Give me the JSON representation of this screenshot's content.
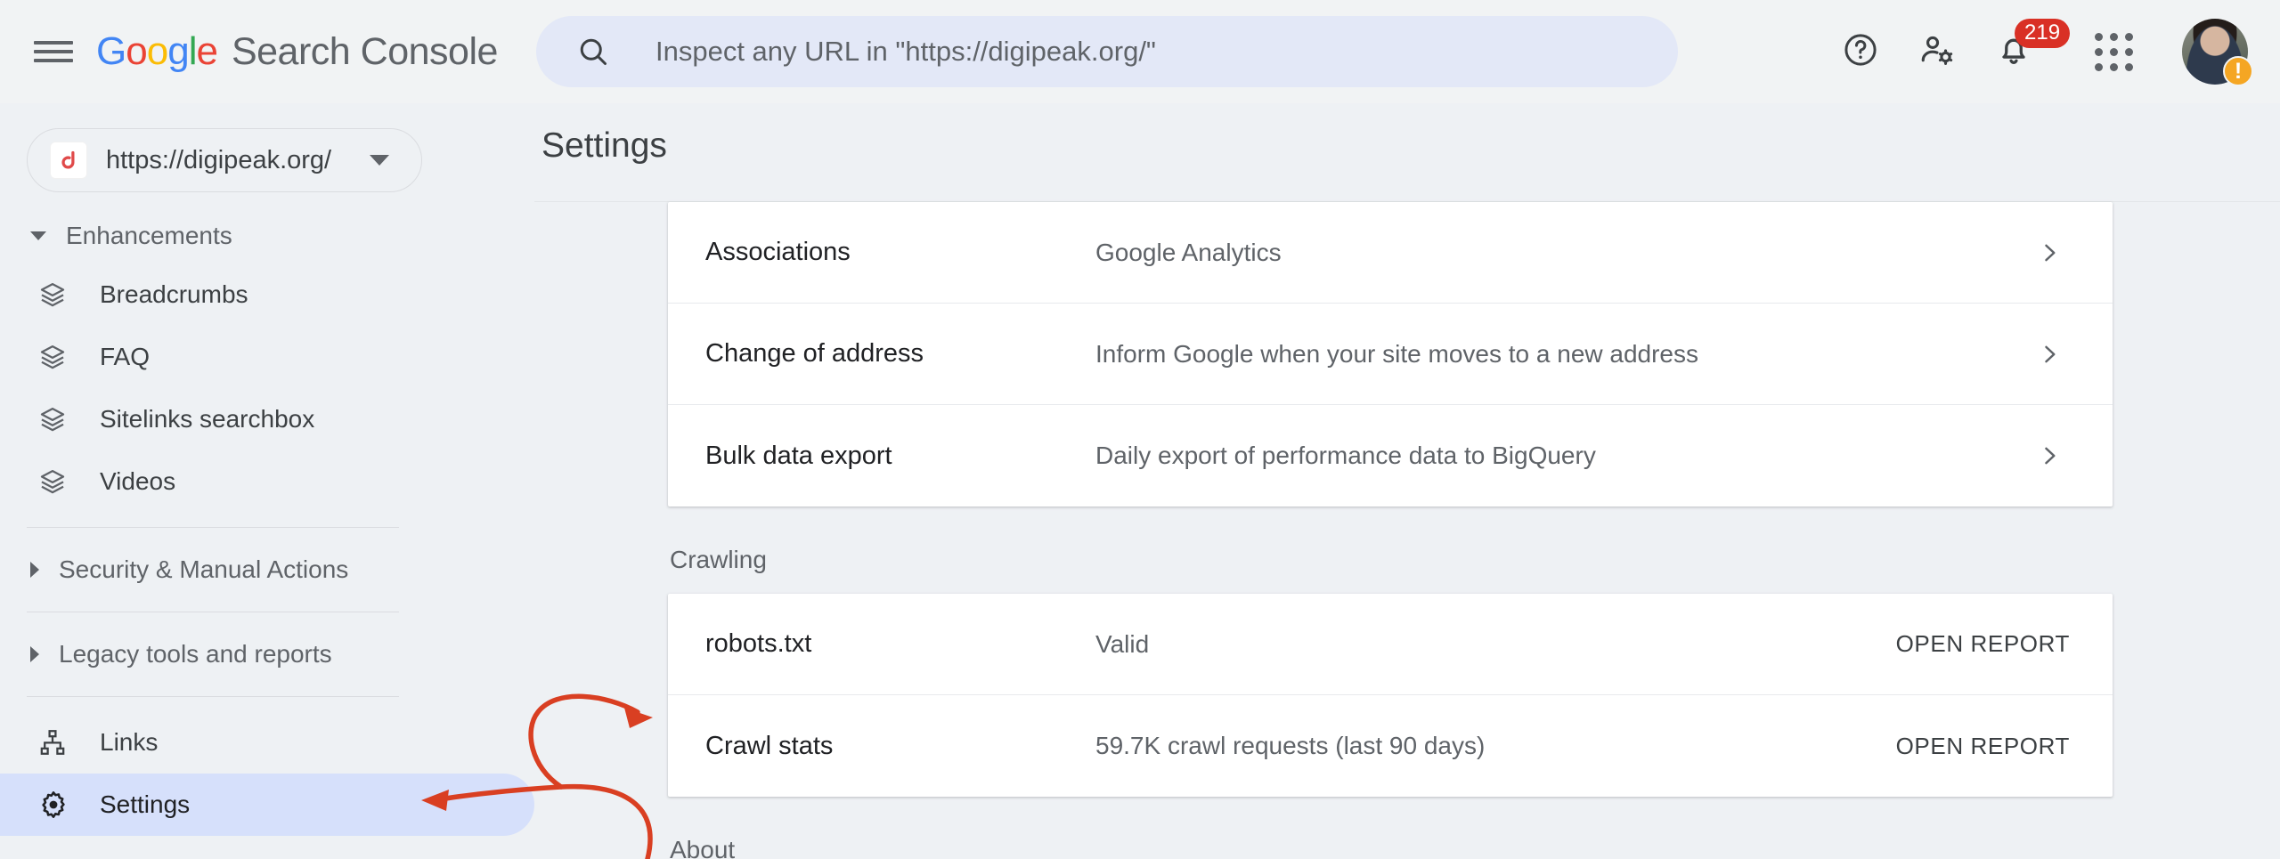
{
  "topbar": {
    "menu_icon": "hamburger-menu-icon",
    "logo_google": "Google",
    "logo_product": "Search Console",
    "search": {
      "icon": "search-icon",
      "placeholder": "Inspect any URL in \"https://digipeak.org/\""
    },
    "help_icon": "help-circle-icon",
    "user_settings_icon": "user-settings-icon",
    "notifications_icon": "notifications-bell-icon",
    "notifications_count": "219",
    "apps_icon": "apps-grid-icon",
    "avatar": "user-avatar",
    "avatar_badge": "!"
  },
  "sidebar": {
    "property": {
      "favicon_letter": "d",
      "url": "https://digipeak.org/",
      "caret": "chevron-down-icon"
    },
    "groups": [
      {
        "label": "Enhancements",
        "expanded": true,
        "items": [
          {
            "label": "Breadcrumbs",
            "icon": "layers-icon"
          },
          {
            "label": "FAQ",
            "icon": "layers-icon"
          },
          {
            "label": "Sitelinks searchbox",
            "icon": "layers-icon"
          },
          {
            "label": "Videos",
            "icon": "layers-icon"
          }
        ]
      },
      {
        "label": "Security & Manual Actions",
        "expanded": false,
        "items": []
      },
      {
        "label": "Legacy tools and reports",
        "expanded": false,
        "items": []
      }
    ],
    "links_item": {
      "label": "Links",
      "icon": "sitemap-icon",
      "active": false
    },
    "settings_item": {
      "label": "Settings",
      "icon": "gear-icon",
      "active": true
    }
  },
  "main": {
    "title": "Settings",
    "top_rows": [
      {
        "title": "Associations",
        "desc": "Google Analytics",
        "action": "chevron-right-icon"
      },
      {
        "title": "Change of address",
        "desc": "Inform Google when your site moves to a new address",
        "action": "chevron-right-icon"
      },
      {
        "title": "Bulk data export",
        "desc": "Daily export of performance data to BigQuery",
        "action": "chevron-right-icon"
      }
    ],
    "crawling_label": "Crawling",
    "crawling_rows": [
      {
        "title": "robots.txt",
        "desc": "Valid",
        "action_label": "Open report"
      },
      {
        "title": "Crawl stats",
        "desc": "59.7K crawl requests (last 90 days)",
        "action_label": "Open report"
      }
    ],
    "about_label": "About"
  },
  "annotation": {
    "color": "#d93f22",
    "shape": "double-headed-curved-arrow"
  },
  "colors": {
    "page_bg": "#eef1f4",
    "topbar_bg": "#f1f3f4",
    "card_bg": "#ffffff",
    "active_nav": "#d6e0fb",
    "search_bg": "#e3e8f7",
    "badge_red": "#d93025",
    "avatar_badge": "#f5a623",
    "annotation_red": "#d93f22",
    "google_blue": "#4285f4",
    "google_red": "#ea4335",
    "google_yellow": "#fbbc05",
    "google_green": "#34a853"
  }
}
